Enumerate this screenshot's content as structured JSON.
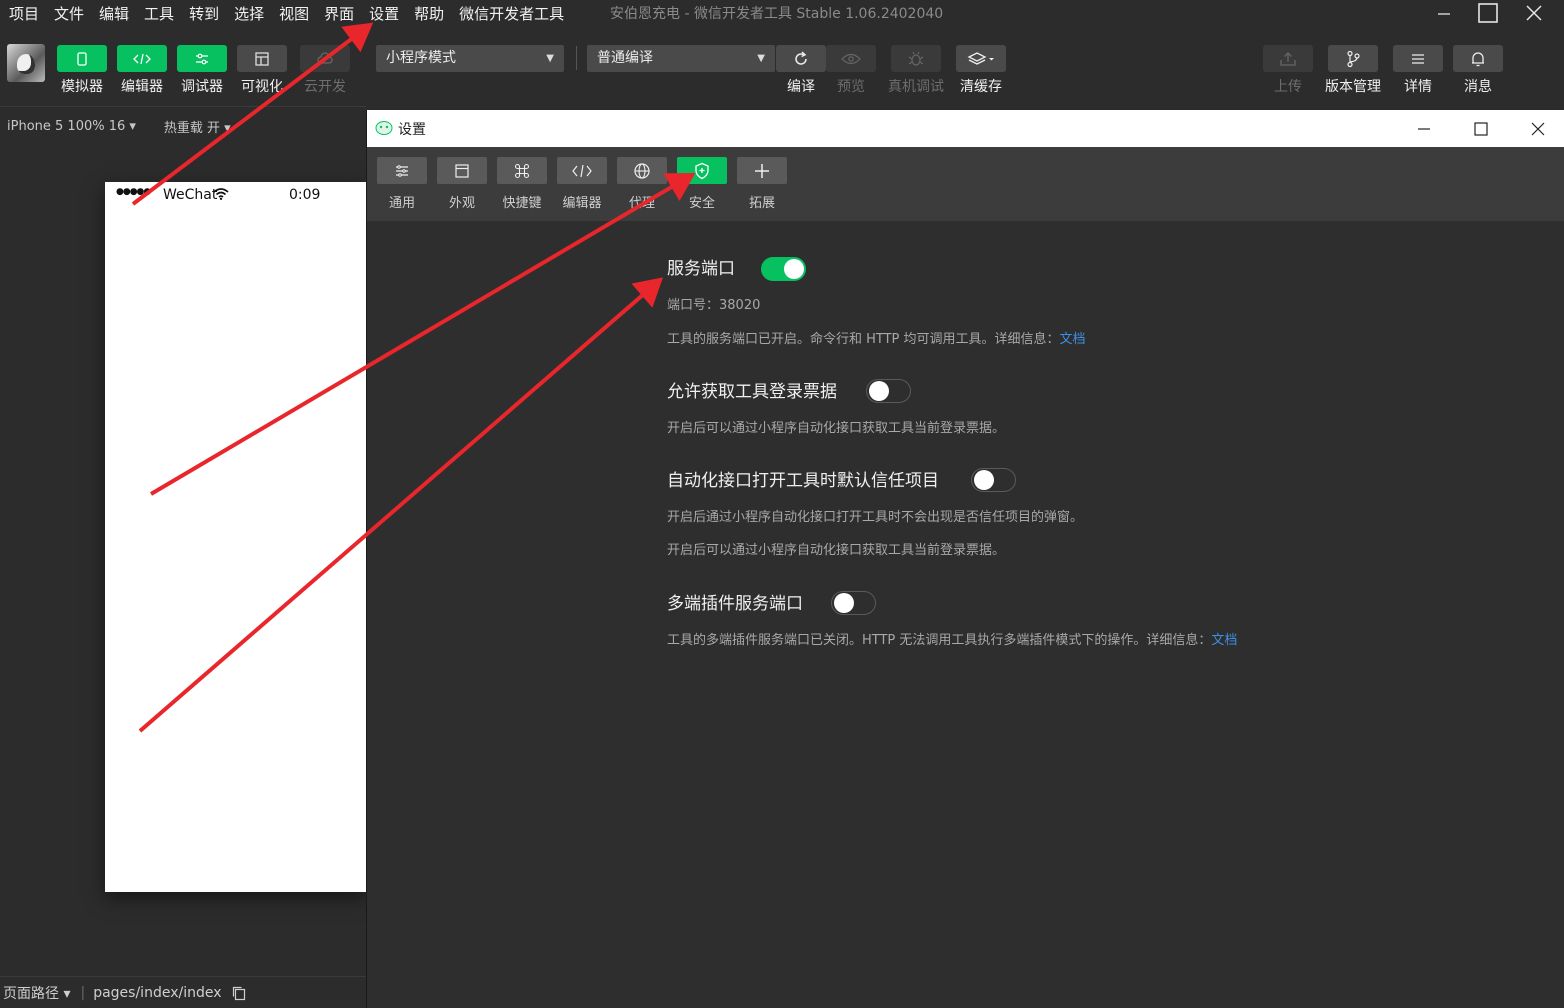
{
  "menubar": {
    "items": [
      "项目",
      "文件",
      "编辑",
      "工具",
      "转到",
      "选择",
      "视图",
      "界面",
      "设置",
      "帮助",
      "微信开发者工具"
    ],
    "window_title": "安伯恩充电 - 微信开发者工具 Stable 1.06.2402040"
  },
  "toolbar": {
    "simulator_label": "模拟器",
    "editor_label": "编辑器",
    "debugger_label": "调试器",
    "visual_label": "可视化",
    "cloud_label": "云开发",
    "mode_select": "小程序模式",
    "compile_select": "普通编译",
    "compile_label": "编译",
    "preview_label": "预览",
    "real_debug_label": "真机调试",
    "clear_cache_label": "清缓存",
    "upload_label": "上传",
    "version_label": "版本管理",
    "details_label": "详情",
    "messages_label": "消息"
  },
  "simbar": {
    "device": "iPhone 5 100% 16 ▾",
    "hot_reload": "热重载 开 ▾"
  },
  "phone": {
    "carrier": "WeChat",
    "time": "0:09"
  },
  "bottombar": {
    "page_path_label": "页面路径 ▾",
    "page_path": "pages/index/index"
  },
  "settings": {
    "title": "设置",
    "tabs": [
      "通用",
      "外观",
      "快捷键",
      "编辑器",
      "代理",
      "安全",
      "拓展"
    ],
    "active_tab": "安全",
    "service_port": {
      "title": "服务端口",
      "enabled": true,
      "port_text": "端口号：38020",
      "desc": "工具的服务端口已开启。命令行和 HTTP 均可调用工具。详细信息：",
      "link": "文档"
    },
    "login_ticket": {
      "title": "允许获取工具登录票据",
      "enabled": false,
      "desc": "开启后可以通过小程序自动化接口获取工具当前登录票据。"
    },
    "auto_trust": {
      "title": "自动化接口打开工具时默认信任项目",
      "enabled": false,
      "desc1": "开启后通过小程序自动化接口打开工具时不会出现是否信任项目的弹窗。",
      "desc2": "开启后可以通过小程序自动化接口获取工具当前登录票据。"
    },
    "multi_plugin": {
      "title": "多端插件服务端口",
      "enabled": false,
      "desc": "工具的多端插件服务端口已关闭。HTTP 无法调用工具执行多端插件模式下的操作。详细信息：",
      "link": "文档"
    }
  },
  "colors": {
    "accent_green": "#07c160",
    "annotation_red": "#e8262b",
    "link_blue": "#3d8fe6"
  }
}
